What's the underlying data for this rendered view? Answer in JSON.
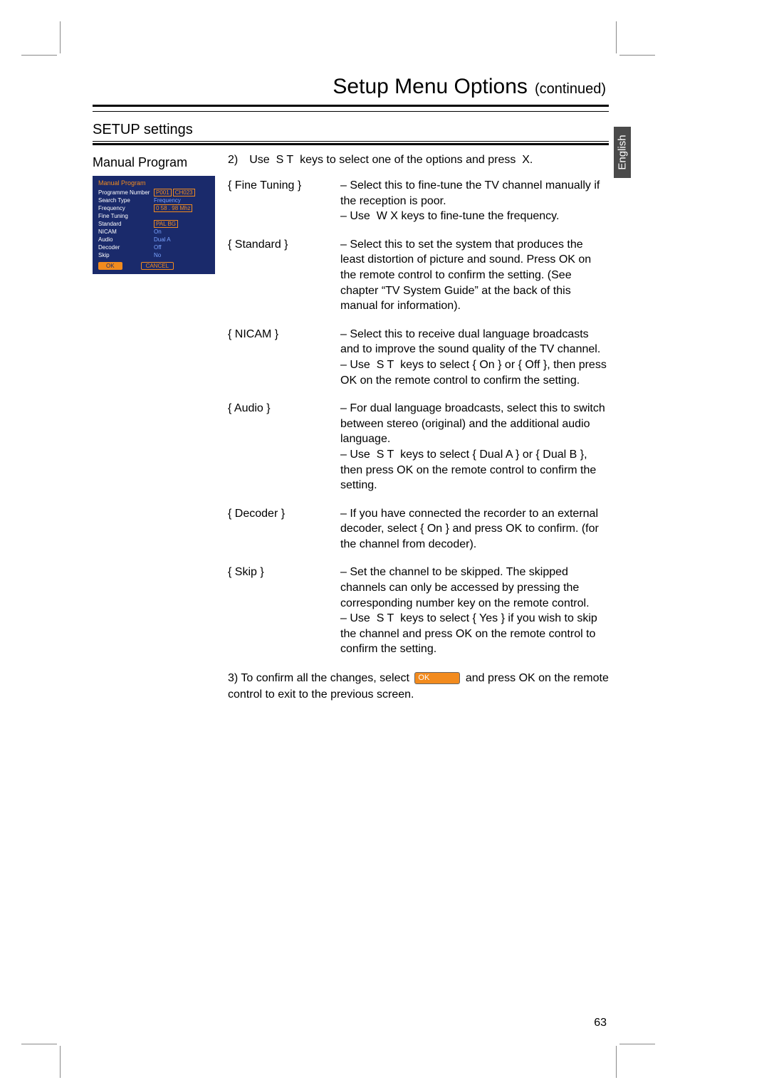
{
  "header": {
    "title": "Setup Menu Options",
    "continued": "(continued)"
  },
  "lang_tab": "English",
  "section_title": "SETUP settings",
  "left_heading": "Manual Program",
  "intro": "2) Use  S T  keys to select one of the options and press  X.",
  "options": [
    {
      "label": "{ Fine Tuning  }",
      "desc": "– Select this to fine-tune the TV channel manually if the reception is poor.\n– Use  W X keys to fine-tune the frequency."
    },
    {
      "label": "{ Standard  }",
      "desc": "– Select this to set the system that produces the least distortion of picture and sound. Press OK on the remote control to confirm the setting. (See chapter “TV System Guide” at the back of this manual for information)."
    },
    {
      "label": "{ NICAM  }",
      "desc": "– Select this to receive dual language broadcasts and to improve the sound quality of the TV channel.\n– Use  S T  keys to select { On } or { Off }, then press OK  on the remote control to confirm the setting."
    },
    {
      "label": "{ Audio  }",
      "desc": "– For dual language broadcasts, select this to switch between stereo (original) and the additional audio language.\n– Use  S T  keys to select { Dual A  } or { Dual B }, then press OK  on the remote control to confirm  the setting."
    },
    {
      "label": "{ Decoder  }",
      "desc": "– If you have connected the recorder to an external decoder, select { On } and press OK  to confirm. (for the channel from decoder)."
    },
    {
      "label": "{ Skip }",
      "desc": "– Set the channel to be skipped. The skipped channels can only be accessed by pressing the corresponding number key on the remote control.\n– Use  S T  keys to select { Yes } if you wish to skip the channel and press OK  on the remote control to confirm the setting."
    }
  ],
  "confirm": {
    "prefix": "3) To confirm all the changes, select",
    "chip": "OK",
    "suffix": "and press OK  on the remote control to exit to the previous screen."
  },
  "osd": {
    "title": "Manual Program",
    "rows": [
      {
        "k": "Programme Number",
        "v": "P001",
        "v2": "CH023",
        "boxed": true
      },
      {
        "k": "Search Type",
        "v": "Frequency"
      },
      {
        "k": "Frequency",
        "v": "0 58 . 98 Mhz",
        "boxed": true
      },
      {
        "k": "Fine Tuning",
        "v": ""
      },
      {
        "k": "Standard",
        "v": "PAL BG",
        "boxed": true
      },
      {
        "k": "NICAM",
        "v": "On"
      },
      {
        "k": "Audio",
        "v": "Dual A"
      },
      {
        "k": "Decoder",
        "v": "Off"
      },
      {
        "k": "Skip",
        "v": "No"
      }
    ],
    "btn_ok": "OK",
    "btn_cancel": "CANCEL"
  },
  "page_number": "63"
}
